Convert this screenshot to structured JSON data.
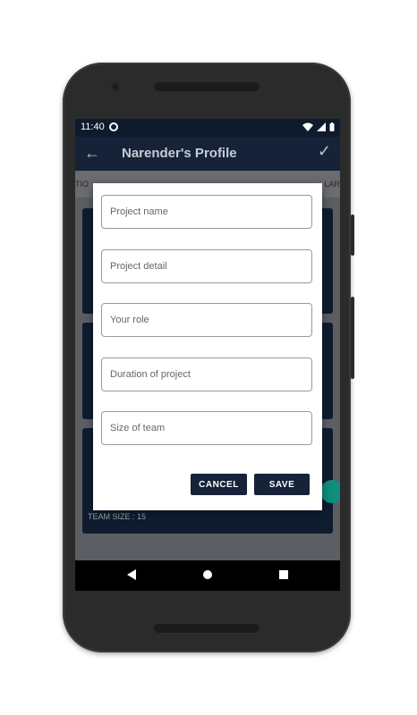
{
  "statusbar": {
    "time": "11:40"
  },
  "appbar": {
    "title": "Narender's Profile"
  },
  "tabs": {
    "left_fragment": "TIO",
    "right_fragment": "LAR"
  },
  "dialog": {
    "fields": [
      {
        "placeholder": "Project name"
      },
      {
        "placeholder": "Project detail"
      },
      {
        "placeholder": "Your role"
      },
      {
        "placeholder": "Duration of project"
      },
      {
        "placeholder": "Size of team"
      }
    ],
    "cancel_label": "CANCEL",
    "save_label": "SAVE"
  },
  "background_cards": [
    {
      "team_size": "TEAM SIZE :  15"
    }
  ],
  "colors": {
    "appbar": "#152238",
    "button": "#152238",
    "fab": "#0e8f7e"
  },
  "icons": {
    "back": "arrow-left-icon",
    "confirm": "check-icon",
    "nav_back": "triangle-back-icon",
    "nav_home": "circle-home-icon",
    "nav_recent": "square-recent-icon"
  }
}
